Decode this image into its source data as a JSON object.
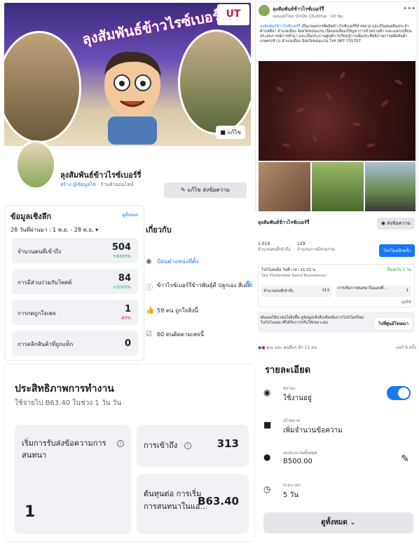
{
  "cover": {
    "title": "ลุงสัมพันธ์ข้าวไรซ์เบอร์รี่",
    "logo_text": "UT",
    "edit_label": "แก้ไข"
  },
  "profile": {
    "name": "ลุงสัมพันธ์ข้าวไรซ์เบอร์รี่",
    "create_label": "สร้าง",
    "username": "@ข้อมูลไข่",
    "category": "ร้านค้าออนไลน์",
    "edit_button": "แก้ไข ส่งข้อความ"
  },
  "insights": {
    "title": "ข้อมูลเชิงลึก",
    "see_all": "ดูทั้งหมด",
    "range": "28 วันที่ผ่านมา : 1 พ.ย. - 28 พ.ย.",
    "stats": [
      {
        "label": "จำนวนคนที่เข้าถึง",
        "value": "504",
        "change": "+8300%",
        "dir": "up"
      },
      {
        "label": "การมีส่วนร่วมกับโพสต์",
        "value": "84",
        "change": "+2000%",
        "dir": "up"
      },
      {
        "label": "การกดถูกใจเพจ",
        "value": "1",
        "change": "-80%",
        "dir": "down"
      },
      {
        "label": "การคลิกสินค้าที่ถูกแท็ก",
        "value": "0",
        "change": "",
        "dir": ""
      }
    ]
  },
  "about": {
    "title": "เกี่ยวกับ",
    "items": [
      {
        "icon": "pin-icon",
        "text": "ป้อนตำแหน่งที่ตั้ง",
        "link": true
      },
      {
        "icon": "info-icon",
        "text": "ข้าวไรซ์เบอร์รี่ข้าวพันธุ์ดี ปลูกเอง สีเอง",
        "link": false
      },
      {
        "icon": "thumb-icon",
        "text": "59 คน ถูกใจสิ่งนี้",
        "link": false
      },
      {
        "icon": "check-icon",
        "text": "60 คนติดตามเพจนี้",
        "link": false
      }
    ]
  },
  "performance": {
    "title": "ประสิทธิภาพการทำงาน",
    "subtitle": "ใช้จ่ายไป B63.40 ในช่วง 1 วัน วัน",
    "cards": [
      {
        "label": "เริ่มการรับส่งข้อความการสนทนา",
        "value": "1"
      },
      {
        "label": "การเข้าถึง",
        "value": "313"
      },
      {
        "label": "ต้นทุนต่อ การเริ่มการสนทนาในแอ...",
        "value": "B63.40"
      }
    ]
  },
  "post": {
    "page_name": "ลุงสัมพันธ์ข้าวไรซ์เบอร์รี่",
    "meta": "เผยแพร่โดย OnOo Chutima · 10 ชม.",
    "text_link": "ลุงสัมพันธ์ข้าวไรซ์เบอร์รี่",
    "text": "เป็นเกษตรกรที่ผลิตข้าวไรซ์เบอร์รี่จำหน่าย และเป็นหมอดินประจำตำบลศิลา อำเภอเมือง จังหวัดขอนแก่น เปิดเพจเพื่อแก้ปัญหาการจำหน่ายข้าวและแลกเปลี่ยนประสบการณ์การทำนา และเป็นประธานศูนย์การเรียนรู้การเพิ่มประสิทธิภาพการผลิตสินค้าเกษตร(ข้าว) อำเภอเมือง จังหวัดขอนแก่น โทร 087-731757"
  },
  "pagerow": {
    "name": "ลุงสัมพันธ์ข้าวไรซ์เบอร์รี่",
    "message_button": "ส่งข้อความ",
    "reach_value": "1,019",
    "reach_label": "จำนวนคนที่เข้าถึง",
    "eng_value": "129",
    "eng_label": "จำนวนการมีส่วนร่วม",
    "boost_button": "โปรโมทอีกครั้ง"
  },
  "ad": {
    "line1": "โปรโมทเมื่อ วันที่ เวลา 11:02 น.",
    "status": "สิ้นสุดใน 5 วัน",
    "line2": "โดย Pholsindee David Boonsomsri",
    "reach_label": "จำนวนคนที่เข้าถึง",
    "reach_value": "313",
    "conv_label": "การเริ่มการสนทนาในแอปที่...",
    "conv_value": "1",
    "more": "ดูสถิติ"
  },
  "promo": {
    "text": "ดันเพจให้น่าสนใจยิ่งขึ้น ดูข้อมูลเชิงลึกเพื่อเพิ่มการโปรโมทใหม่ไปกับโฆษณาที่ได้รับการปรับให้เหมาะสม",
    "button": "ไปที่ศูนย์โฆษณา"
  },
  "reactions": {
    "left": "คุณ และ คนอื่นๆ อีก 15 คน",
    "right": "แชร์ 6 ครั้ง"
  },
  "details": {
    "title": "รายละเอียด",
    "rows": [
      {
        "icon": "status-icon",
        "label": "สถานะ",
        "value": "ใช้งานอยู่"
      },
      {
        "icon": "target-icon",
        "label": "เป้าหมาย",
        "value": "เพิ่มจำนวนข้อความ"
      },
      {
        "icon": "budget-icon",
        "label": "งบประมาณทั้งหมด",
        "value": "B500.00"
      },
      {
        "icon": "clock-icon",
        "label": "ระยะเวลา",
        "value": "5 วัน"
      }
    ],
    "see_all": "ดูทั้งหมด"
  },
  "colors": {
    "accent": "#1877f2",
    "up": "#31a24c",
    "down": "#e41e3f"
  }
}
